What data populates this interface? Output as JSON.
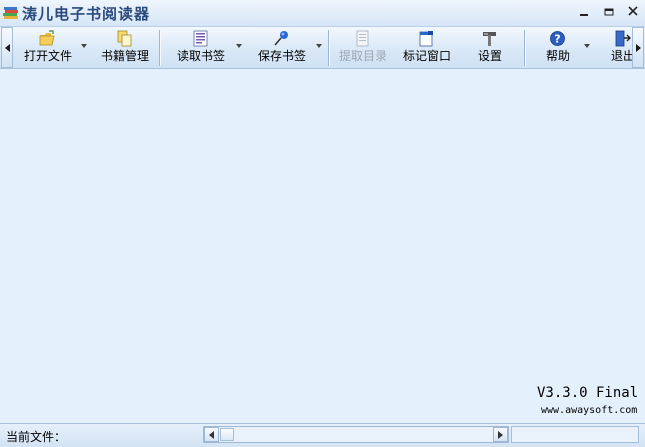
{
  "window": {
    "title": "涛儿电子书阅读器"
  },
  "toolbar": {
    "open_file": "打开文件",
    "library": "书籍管理",
    "read_bookmark": "读取书签",
    "save_bookmark": "保存书签",
    "extract_toc": "提取目录",
    "mark_window": "标记窗口",
    "settings": "设置",
    "help": "帮助",
    "exit": "退出"
  },
  "main": {
    "version": "V3.3.0 Final",
    "website": "www.awaysoft.com"
  },
  "statusbar": {
    "current_file_label": "当前文件："
  },
  "colors": {
    "background": "#e4f0fb",
    "title_text": "#2b4a7c",
    "disabled_text": "#9aa6b4"
  }
}
